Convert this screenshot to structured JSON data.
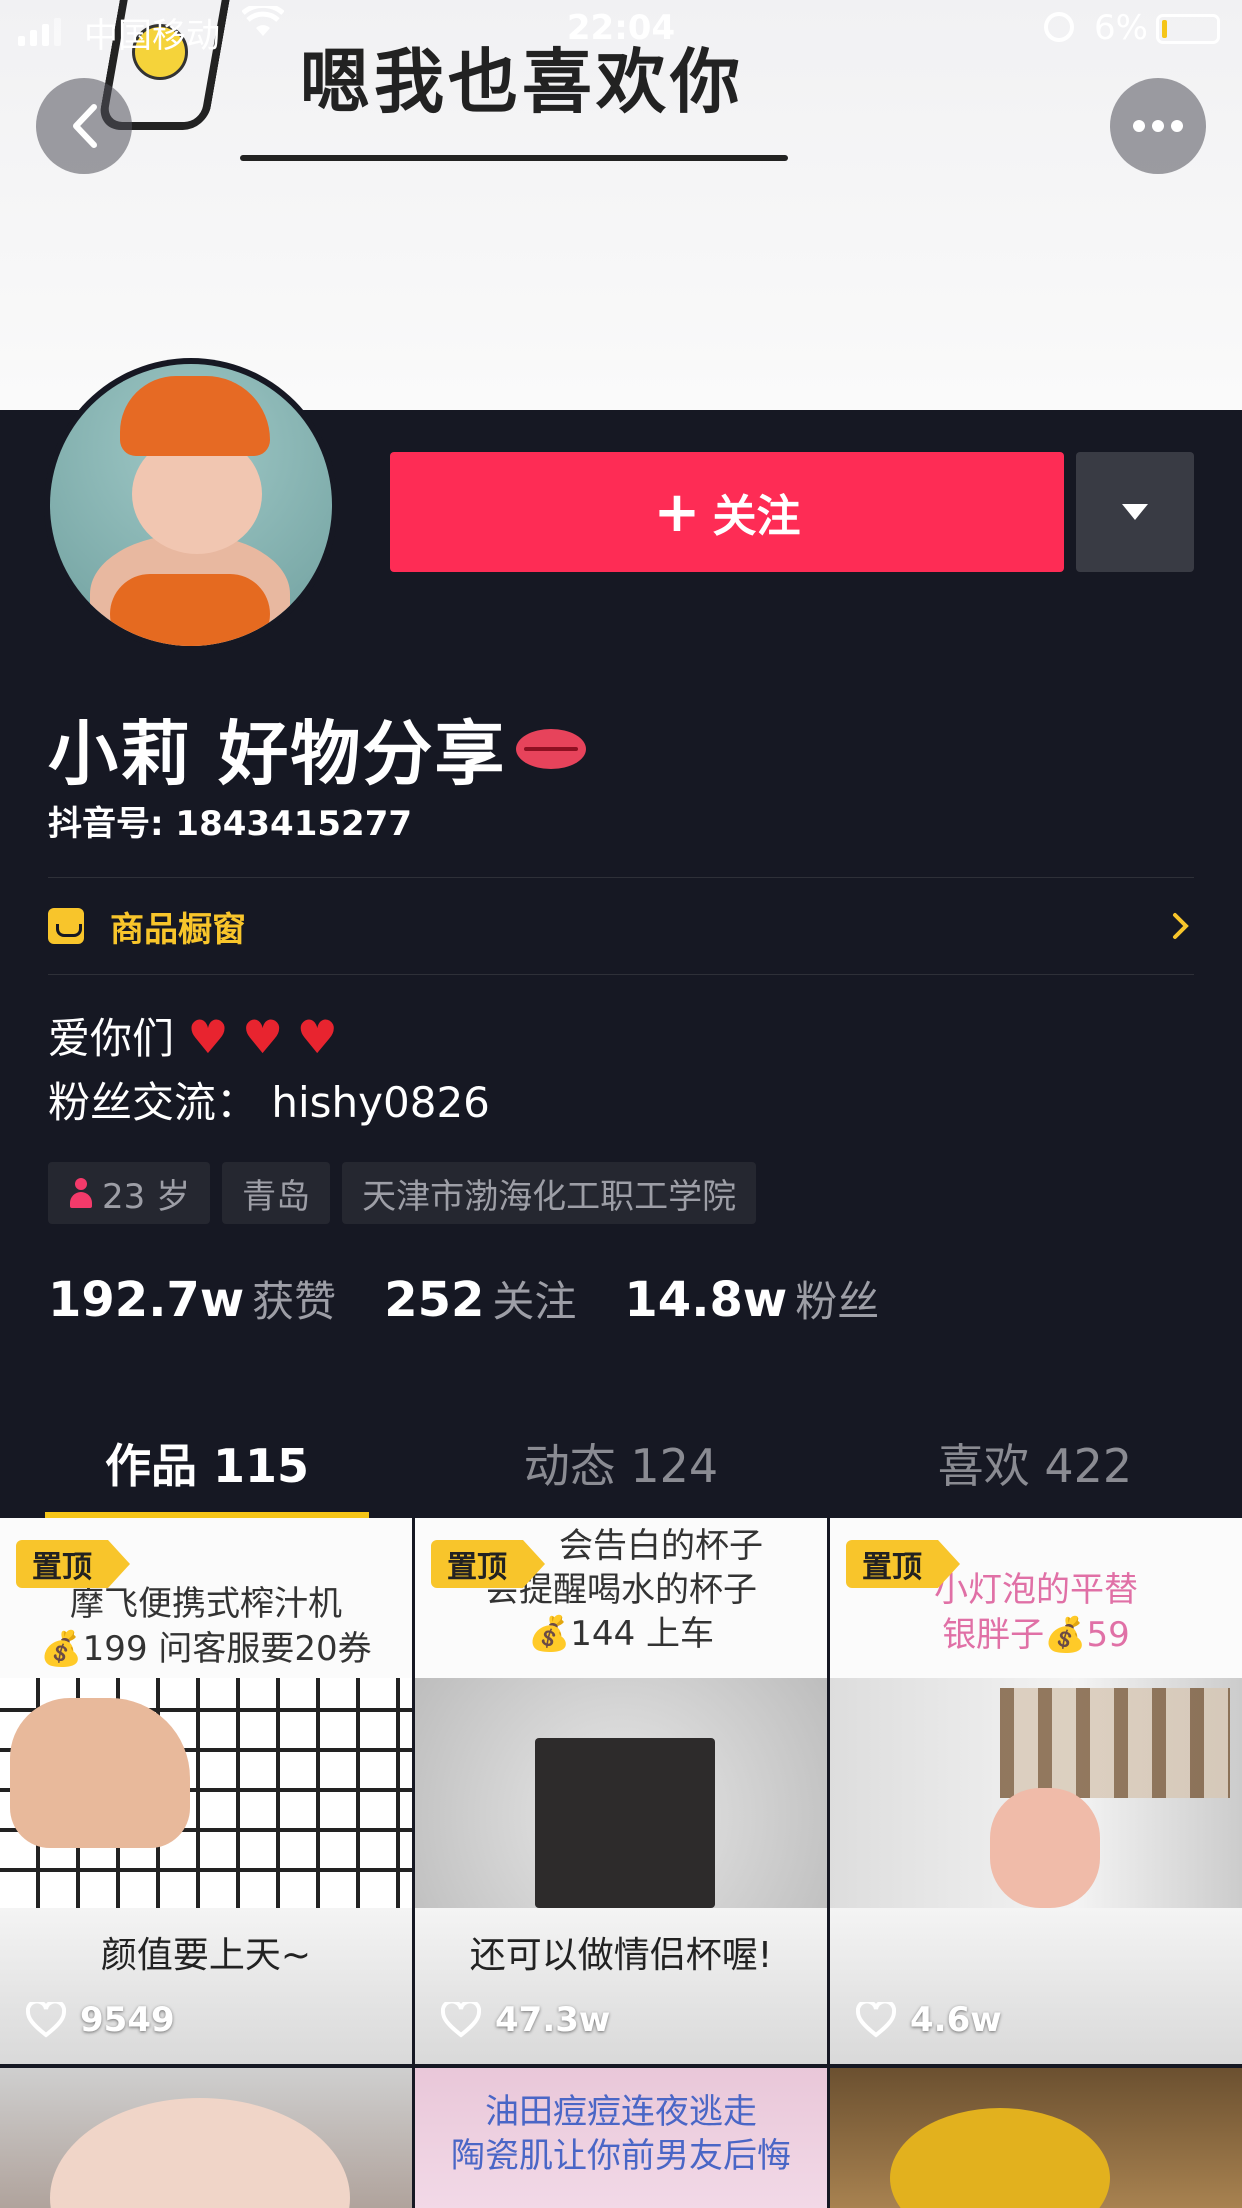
{
  "status_bar": {
    "carrier": "中国移动",
    "time": "22:04",
    "battery": "6%"
  },
  "banner": {
    "text": "嗯我也喜欢你"
  },
  "profile": {
    "follow_label": "关注",
    "name": "小莉  好物分享",
    "douyin_id": "抖音号: 1843415277",
    "shop_window": "商品橱窗",
    "bio_line1": "爱你们",
    "bio_line2": "粉丝交流：  hishy0826",
    "tags": {
      "age": "23 岁",
      "city": "青岛",
      "school": "天津市渤海化工职工学院"
    },
    "stats": {
      "likes_num": "192.7w",
      "likes_label": "获赞",
      "following_num": "252",
      "following_label": "关注",
      "fans_num": "14.8w",
      "fans_label": "粉丝"
    }
  },
  "tabs": [
    {
      "label": "作品 115"
    },
    {
      "label": "动态 124"
    },
    {
      "label": "喜欢 422"
    }
  ],
  "videos": [
    {
      "pin": "置顶",
      "top_line1": "摩飞便携式榨汁机",
      "top_line2": "💰199 问客服要20券",
      "bottom": "颜值要上天~",
      "likes": "9549"
    },
    {
      "pin": "置顶",
      "top_line1": "会告白的杯子",
      "top_line2": "会提醒喝水的杯子",
      "top_line3": "💰144 上车",
      "bottom": "还可以做情侣杯喔!",
      "likes": "47.3w"
    },
    {
      "pin": "置顶",
      "top_line1": "小灯泡的平替",
      "top_line2": "银胖子💰59",
      "likes": "4.6w"
    },
    {},
    {
      "overlay_line1": "油田痘痘连夜逃走",
      "overlay_line2": "陶瓷肌让你前男友后悔"
    },
    {}
  ],
  "colors": {
    "background": "#161823",
    "follow_red": "#fe2c55",
    "accent_yellow": "#f8c52b"
  }
}
